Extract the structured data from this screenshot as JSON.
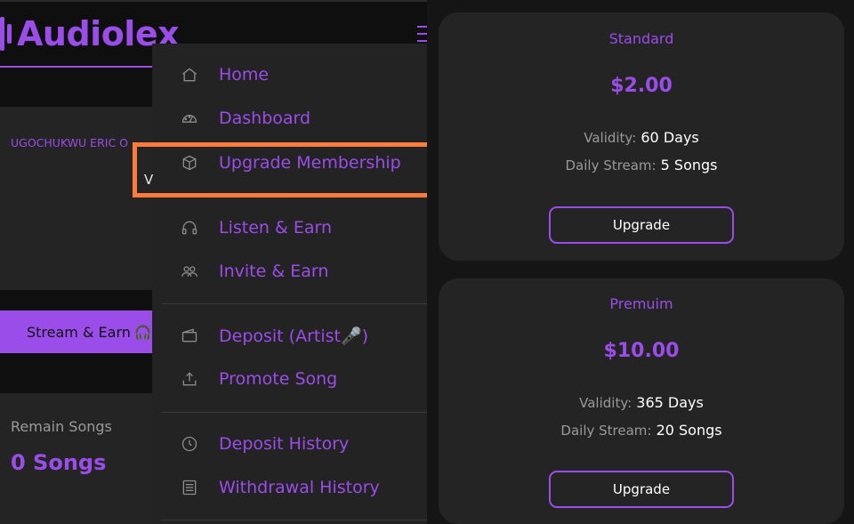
{
  "app": {
    "brand": "Audiolex"
  },
  "profile": {
    "name": "UGOCHUKWU ERIC O",
    "peek_letter": "V"
  },
  "stream_button": {
    "label": "Stream & Earn",
    "icon": "headphones-emoji"
  },
  "remain": {
    "label": "Remain Songs",
    "value": "0 Songs"
  },
  "menu": {
    "items": [
      {
        "label": "Home",
        "icon": "home-icon"
      },
      {
        "label": "Dashboard",
        "icon": "dashboard-gauge-icon"
      },
      {
        "label": "Upgrade Membership",
        "icon": "box-icon",
        "highlighted": true
      },
      {
        "label": "Listen & Earn",
        "icon": "headphones-icon"
      },
      {
        "label": "Invite & Earn",
        "icon": "users-icon"
      },
      {
        "label": "Deposit (Artist🎤)",
        "icon": "wallet-icon"
      },
      {
        "label": "Promote Song",
        "icon": "upload-icon"
      },
      {
        "label": "Deposit History",
        "icon": "clock-icon"
      },
      {
        "label": "Withdrawal History",
        "icon": "receipt-icon"
      }
    ]
  },
  "plans": [
    {
      "name": "Standard",
      "price": "$2.00",
      "validity_label": "Validity:",
      "validity_value": "60 Days",
      "daily_label": "Daily Stream:",
      "daily_value": "5 Songs",
      "button": "Upgrade"
    },
    {
      "name": "Premuim",
      "price": "$10.00",
      "validity_label": "Validity:",
      "validity_value": "365 Days",
      "daily_label": "Daily Stream:",
      "daily_value": "20 Songs",
      "button": "Upgrade"
    }
  ],
  "colors": {
    "accent": "#9b4dea",
    "highlight": "#ff7a3d",
    "card": "#242424"
  }
}
